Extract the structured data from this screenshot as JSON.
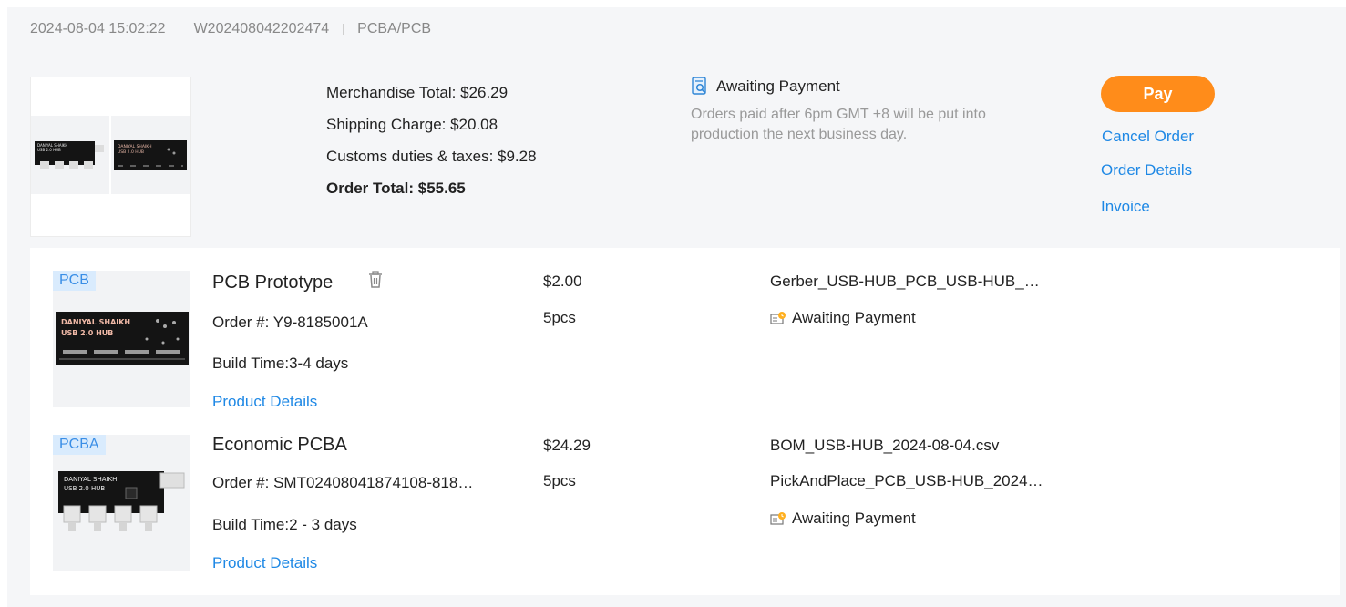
{
  "header": {
    "datetime": "2024-08-04 15:02:22",
    "order_id": "W202408042202474",
    "category": "PCBA/PCB"
  },
  "summary": {
    "merchandise_total": "Merchandise Total: $26.29",
    "shipping_charge": "Shipping Charge: $20.08",
    "customs": "Customs duties & taxes: $9.28",
    "order_total": "Order Total: $55.65",
    "status": "Awaiting Payment",
    "note": "Orders paid after 6pm GMT +8 will be put into production the next business day."
  },
  "actions": {
    "pay": "Pay",
    "cancel": "Cancel Order",
    "details": "Order Details",
    "invoice": "Invoice"
  },
  "board_text": {
    "line1": "DANIYAL SHAIKH",
    "line2": "USB 2.0 HUB"
  },
  "items": [
    {
      "tag": "PCB",
      "title": "PCB Prototype",
      "order_no": "Order #: Y9-8185001A",
      "build_time": "Build Time:3-4 days",
      "details_link": "Product Details",
      "price": "$2.00",
      "qty": "5pcs",
      "file1": "Gerber_USB-HUB_PCB_USB-HUB_…",
      "status": "Awaiting Payment"
    },
    {
      "tag": "PCBA",
      "title": "Economic PCBA",
      "order_no": "Order #: SMT02408041874108-818…",
      "build_time": "Build Time:2 - 3 days",
      "details_link": "Product Details",
      "price": "$24.29",
      "qty": "5pcs",
      "file1": "BOM_USB-HUB_2024-08-04.csv",
      "file2": "PickAndPlace_PCB_USB-HUB_2024…",
      "status": "Awaiting Payment"
    }
  ],
  "colors": {
    "accent": "#1e88e5",
    "pay": "#ff8c1a",
    "tag_bg": "#d9ebfd",
    "panel_bg": "#f5f6f8"
  },
  "icons": {
    "status_top": "document-search-icon",
    "status_item": "pending-payment-icon",
    "delete": "trash-icon"
  }
}
